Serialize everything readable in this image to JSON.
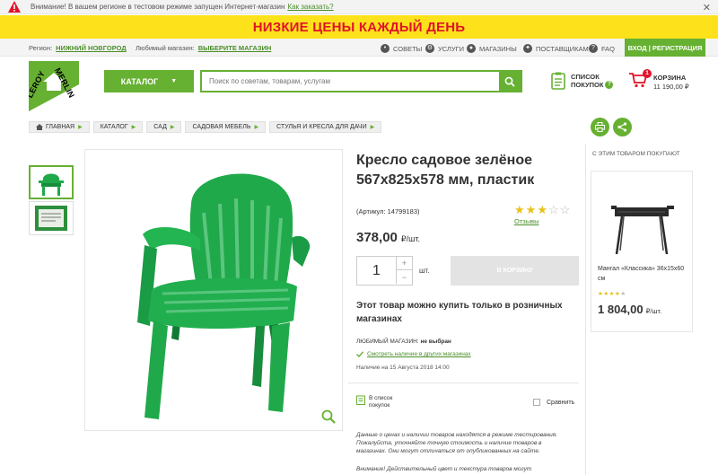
{
  "alert": {
    "text": "Внимание! В вашем регионе в тестовом режиме запущен Интернет-магазин",
    "link": "Как заказать?",
    "close": "✕"
  },
  "promo": {
    "text": "НИЗКИЕ ЦЕНЫ КАЖДЫЙ ДЕНЬ"
  },
  "topnav": {
    "region_label": "Регион:",
    "region_value": "НИЖНИЙ НОВГОРОД",
    "store_label": "Любимый магазин:",
    "store_value": "ВЫБЕРИТЕ МАГАЗИН",
    "links": [
      "СОВЕТЫ",
      "УСЛУГИ",
      "МАГАЗИНЫ",
      "ПОСТАВЩИКАМ",
      "FAQ"
    ],
    "login": "ВХОД | РЕГИСТРАЦИЯ"
  },
  "logo": {
    "line1": "LEROY",
    "line2": "MERLIN"
  },
  "header": {
    "catalog": "КАТАЛОГ",
    "search_placeholder": "Поиск по советам, товарам, услугам",
    "shoplist_line1": "СПИСОК",
    "shoplist_line2": "ПОКУПОК",
    "cart_count": "1",
    "cart_label": "КОРЗИНА",
    "cart_sum": "11 190,00 ₽"
  },
  "breadcrumbs": [
    "ГЛАВНАЯ",
    "КАТАЛОГ",
    "САД",
    "САДОВАЯ МЕБЕЛЬ",
    "СТУЛЬЯ И КРЕСЛА ДЛЯ ДАЧИ"
  ],
  "product": {
    "title": "Кресло садовое зелёное 567х825х578 мм, пластик",
    "article": "(Артикул: 14799183)",
    "rating": 3,
    "rating_max": 5,
    "reviews": "Отзывы",
    "price": "378,00",
    "price_unit": "₽/шт.",
    "qty": "1",
    "qty_unit": "шт.",
    "to_cart": "В КОРЗИНУ",
    "notice": "Этот товар можно купить только в розничных магазинах",
    "store_label": "ЛЮБИМЫЙ МАГАЗИН:",
    "store_value": "не выбран",
    "availability_link": "Смотреть наличие в других магазинах",
    "as_of": "Наличие на 15 Августа 2018 14:00",
    "in_list": "В список покупок",
    "compare": "Сравнить",
    "disclaimer": "Данные о ценах и наличии товаров находятся в режиме тестирования. Пожалуйста, уточняйте точную стоимость и наличие товаров в магазинах. Они могут отличаться от опубликованных на сайте.",
    "disclaimer2": "Внимание! Действительный цвет и текстура товаров могут"
  },
  "related": {
    "heading": "С ЭТИМ ТОВАРОМ ПОКУПАЮТ",
    "name": "Мангал «Классика» 36х15х60 см",
    "rating": 4,
    "rating_max": 5,
    "price": "1 804,00",
    "price_unit": "₽/шт."
  },
  "colors": {
    "brand_green": "#66b032",
    "promo_yellow": "#fde11b",
    "promo_red": "#e1132a",
    "chair_green": "#1fa94a"
  }
}
